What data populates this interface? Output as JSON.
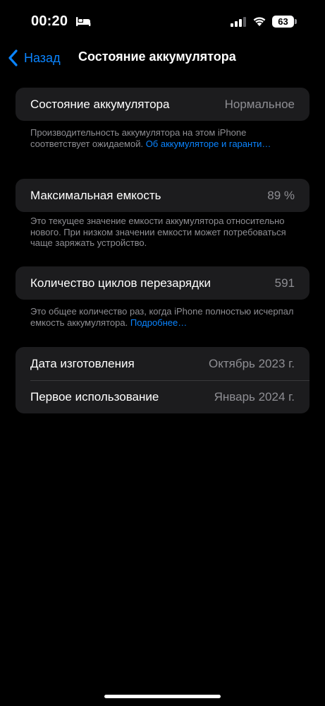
{
  "status_bar": {
    "time": "00:20",
    "battery_percent": "63",
    "icons": [
      "bed-icon",
      "cellular-signal-icon",
      "wifi-icon",
      "battery-icon"
    ]
  },
  "nav": {
    "back_label": "Назад",
    "title": "Состояние аккумулятора"
  },
  "battery_health": {
    "label": "Состояние аккумулятора",
    "value": "Нормальное",
    "footnote_text": "Производительность аккумулятора на этом iPhone соответствует ожидаемой.",
    "footnote_link": "Об аккумуляторе и гаран­ти…"
  },
  "max_capacity": {
    "label": "Максимальная емкость",
    "value": "89 %",
    "footnote_text": "Это текущее значение емкости аккумулятора относительно нового. При низком значении емкости может потребоваться чаще заряжать устройство."
  },
  "cycle_count": {
    "label": "Количество циклов перезарядки",
    "value": "591",
    "footnote_text": "Это общее количество раз, когда iPhone полностью исчерпал емкость аккумулятора.",
    "footnote_link": "Подробнее…"
  },
  "dates": {
    "manufacture_label": "Дата изготовления",
    "manufacture_value": "Октябрь 2023 г.",
    "first_use_label": "Первое использование",
    "first_use_value": "Январь 2024 г."
  },
  "colors": {
    "background": "#000000",
    "group_background": "#1c1c1e",
    "accent": "#0a84ff",
    "secondary_text": "#8e8e93"
  }
}
